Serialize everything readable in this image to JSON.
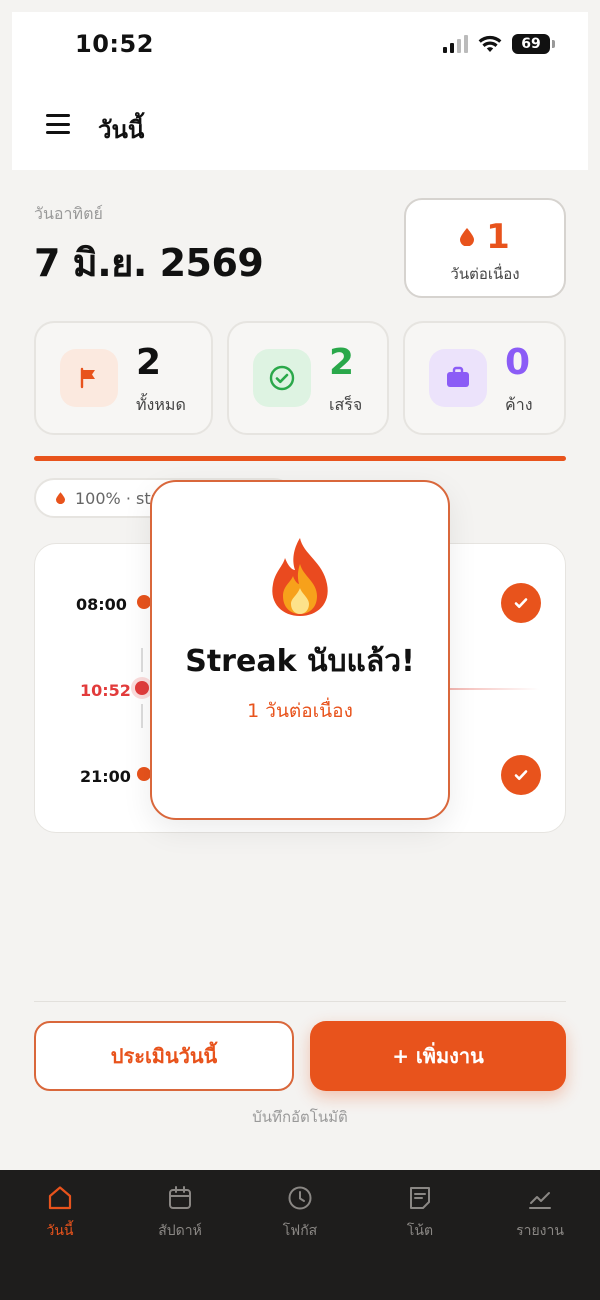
{
  "status_bar": {
    "time": "10:52",
    "battery": "69"
  },
  "header": {
    "title": "วันนี้"
  },
  "date": {
    "day_name": "วันอาทิตย์",
    "full": "7 มิ.ย. 2569"
  },
  "streak": {
    "count": "1",
    "label": "วันต่อเนื่อง"
  },
  "stats": [
    {
      "value": "2",
      "label": "ทั้งหมด",
      "color": "#111111"
    },
    {
      "value": "2",
      "label": "เสร็จ",
      "color": "#2aa84a"
    },
    {
      "value": "0",
      "label": "ค้าง",
      "color": "#8b5cf6"
    }
  ],
  "progress": {
    "percent": 100
  },
  "pill": {
    "text": "100% · str"
  },
  "timeline": {
    "entries": [
      {
        "time": "08:00",
        "done": true
      },
      {
        "time": "10:52",
        "is_now": true
      },
      {
        "time": "21:00",
        "done": true
      }
    ]
  },
  "modal": {
    "title": "Streak นับแล้ว!",
    "subtitle": "1 วันต่อเนื่อง"
  },
  "actions": {
    "evaluate_label": "ประเมินวันนี้",
    "add_label": "+ เพิ่มงาน"
  },
  "autosave_text": "บันทึกอัตโนมัติ",
  "nav": [
    {
      "label": "วันนี้",
      "icon": "home-icon",
      "active": true
    },
    {
      "label": "สัปดาห์",
      "icon": "calendar-icon"
    },
    {
      "label": "โฟกัส",
      "icon": "clock-icon"
    },
    {
      "label": "โน้ต",
      "icon": "note-icon"
    },
    {
      "label": "รายงาน",
      "icon": "chart-icon"
    }
  ],
  "colors": {
    "accent": "#e8531c",
    "done": "#2aa84a",
    "pending": "#8b5cf6",
    "now": "#e23b3b"
  }
}
